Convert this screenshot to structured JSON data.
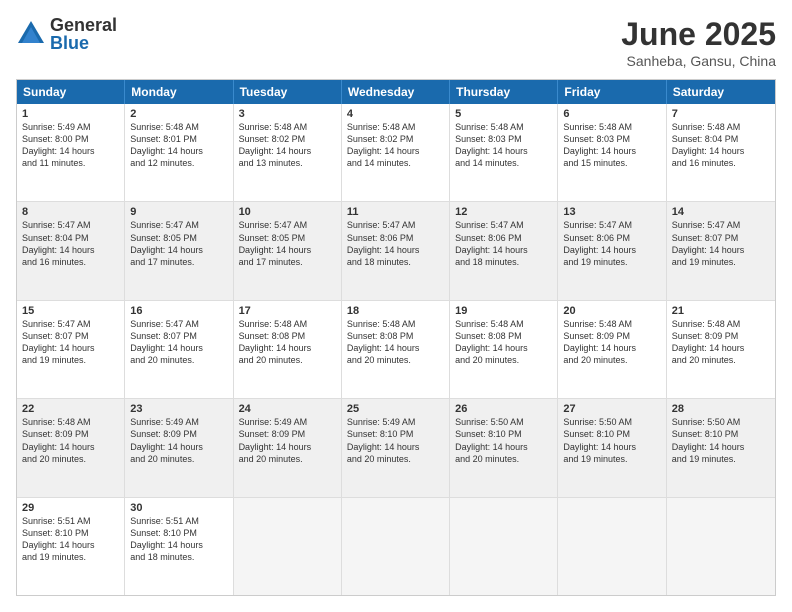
{
  "logo": {
    "general": "General",
    "blue": "Blue"
  },
  "title": "June 2025",
  "location": "Sanheba, Gansu, China",
  "days": [
    "Sunday",
    "Monday",
    "Tuesday",
    "Wednesday",
    "Thursday",
    "Friday",
    "Saturday"
  ],
  "rows": [
    [
      {
        "day": "1",
        "lines": [
          "Sunrise: 5:49 AM",
          "Sunset: 8:00 PM",
          "Daylight: 14 hours",
          "and 11 minutes."
        ]
      },
      {
        "day": "2",
        "lines": [
          "Sunrise: 5:48 AM",
          "Sunset: 8:01 PM",
          "Daylight: 14 hours",
          "and 12 minutes."
        ]
      },
      {
        "day": "3",
        "lines": [
          "Sunrise: 5:48 AM",
          "Sunset: 8:02 PM",
          "Daylight: 14 hours",
          "and 13 minutes."
        ]
      },
      {
        "day": "4",
        "lines": [
          "Sunrise: 5:48 AM",
          "Sunset: 8:02 PM",
          "Daylight: 14 hours",
          "and 14 minutes."
        ]
      },
      {
        "day": "5",
        "lines": [
          "Sunrise: 5:48 AM",
          "Sunset: 8:03 PM",
          "Daylight: 14 hours",
          "and 14 minutes."
        ]
      },
      {
        "day": "6",
        "lines": [
          "Sunrise: 5:48 AM",
          "Sunset: 8:03 PM",
          "Daylight: 14 hours",
          "and 15 minutes."
        ]
      },
      {
        "day": "7",
        "lines": [
          "Sunrise: 5:48 AM",
          "Sunset: 8:04 PM",
          "Daylight: 14 hours",
          "and 16 minutes."
        ]
      }
    ],
    [
      {
        "day": "8",
        "lines": [
          "Sunrise: 5:47 AM",
          "Sunset: 8:04 PM",
          "Daylight: 14 hours",
          "and 16 minutes."
        ]
      },
      {
        "day": "9",
        "lines": [
          "Sunrise: 5:47 AM",
          "Sunset: 8:05 PM",
          "Daylight: 14 hours",
          "and 17 minutes."
        ]
      },
      {
        "day": "10",
        "lines": [
          "Sunrise: 5:47 AM",
          "Sunset: 8:05 PM",
          "Daylight: 14 hours",
          "and 17 minutes."
        ]
      },
      {
        "day": "11",
        "lines": [
          "Sunrise: 5:47 AM",
          "Sunset: 8:06 PM",
          "Daylight: 14 hours",
          "and 18 minutes."
        ]
      },
      {
        "day": "12",
        "lines": [
          "Sunrise: 5:47 AM",
          "Sunset: 8:06 PM",
          "Daylight: 14 hours",
          "and 18 minutes."
        ]
      },
      {
        "day": "13",
        "lines": [
          "Sunrise: 5:47 AM",
          "Sunset: 8:06 PM",
          "Daylight: 14 hours",
          "and 19 minutes."
        ]
      },
      {
        "day": "14",
        "lines": [
          "Sunrise: 5:47 AM",
          "Sunset: 8:07 PM",
          "Daylight: 14 hours",
          "and 19 minutes."
        ]
      }
    ],
    [
      {
        "day": "15",
        "lines": [
          "Sunrise: 5:47 AM",
          "Sunset: 8:07 PM",
          "Daylight: 14 hours",
          "and 19 minutes."
        ]
      },
      {
        "day": "16",
        "lines": [
          "Sunrise: 5:47 AM",
          "Sunset: 8:07 PM",
          "Daylight: 14 hours",
          "and 20 minutes."
        ]
      },
      {
        "day": "17",
        "lines": [
          "Sunrise: 5:48 AM",
          "Sunset: 8:08 PM",
          "Daylight: 14 hours",
          "and 20 minutes."
        ]
      },
      {
        "day": "18",
        "lines": [
          "Sunrise: 5:48 AM",
          "Sunset: 8:08 PM",
          "Daylight: 14 hours",
          "and 20 minutes."
        ]
      },
      {
        "day": "19",
        "lines": [
          "Sunrise: 5:48 AM",
          "Sunset: 8:08 PM",
          "Daylight: 14 hours",
          "and 20 minutes."
        ]
      },
      {
        "day": "20",
        "lines": [
          "Sunrise: 5:48 AM",
          "Sunset: 8:09 PM",
          "Daylight: 14 hours",
          "and 20 minutes."
        ]
      },
      {
        "day": "21",
        "lines": [
          "Sunrise: 5:48 AM",
          "Sunset: 8:09 PM",
          "Daylight: 14 hours",
          "and 20 minutes."
        ]
      }
    ],
    [
      {
        "day": "22",
        "lines": [
          "Sunrise: 5:48 AM",
          "Sunset: 8:09 PM",
          "Daylight: 14 hours",
          "and 20 minutes."
        ]
      },
      {
        "day": "23",
        "lines": [
          "Sunrise: 5:49 AM",
          "Sunset: 8:09 PM",
          "Daylight: 14 hours",
          "and 20 minutes."
        ]
      },
      {
        "day": "24",
        "lines": [
          "Sunrise: 5:49 AM",
          "Sunset: 8:09 PM",
          "Daylight: 14 hours",
          "and 20 minutes."
        ]
      },
      {
        "day": "25",
        "lines": [
          "Sunrise: 5:49 AM",
          "Sunset: 8:10 PM",
          "Daylight: 14 hours",
          "and 20 minutes."
        ]
      },
      {
        "day": "26",
        "lines": [
          "Sunrise: 5:50 AM",
          "Sunset: 8:10 PM",
          "Daylight: 14 hours",
          "and 20 minutes."
        ]
      },
      {
        "day": "27",
        "lines": [
          "Sunrise: 5:50 AM",
          "Sunset: 8:10 PM",
          "Daylight: 14 hours",
          "and 19 minutes."
        ]
      },
      {
        "day": "28",
        "lines": [
          "Sunrise: 5:50 AM",
          "Sunset: 8:10 PM",
          "Daylight: 14 hours",
          "and 19 minutes."
        ]
      }
    ],
    [
      {
        "day": "29",
        "lines": [
          "Sunrise: 5:51 AM",
          "Sunset: 8:10 PM",
          "Daylight: 14 hours",
          "and 19 minutes."
        ]
      },
      {
        "day": "30",
        "lines": [
          "Sunrise: 5:51 AM",
          "Sunset: 8:10 PM",
          "Daylight: 14 hours",
          "and 18 minutes."
        ]
      },
      {
        "day": "",
        "lines": [],
        "empty": true
      },
      {
        "day": "",
        "lines": [],
        "empty": true
      },
      {
        "day": "",
        "lines": [],
        "empty": true
      },
      {
        "day": "",
        "lines": [],
        "empty": true
      },
      {
        "day": "",
        "lines": [],
        "empty": true
      }
    ]
  ]
}
